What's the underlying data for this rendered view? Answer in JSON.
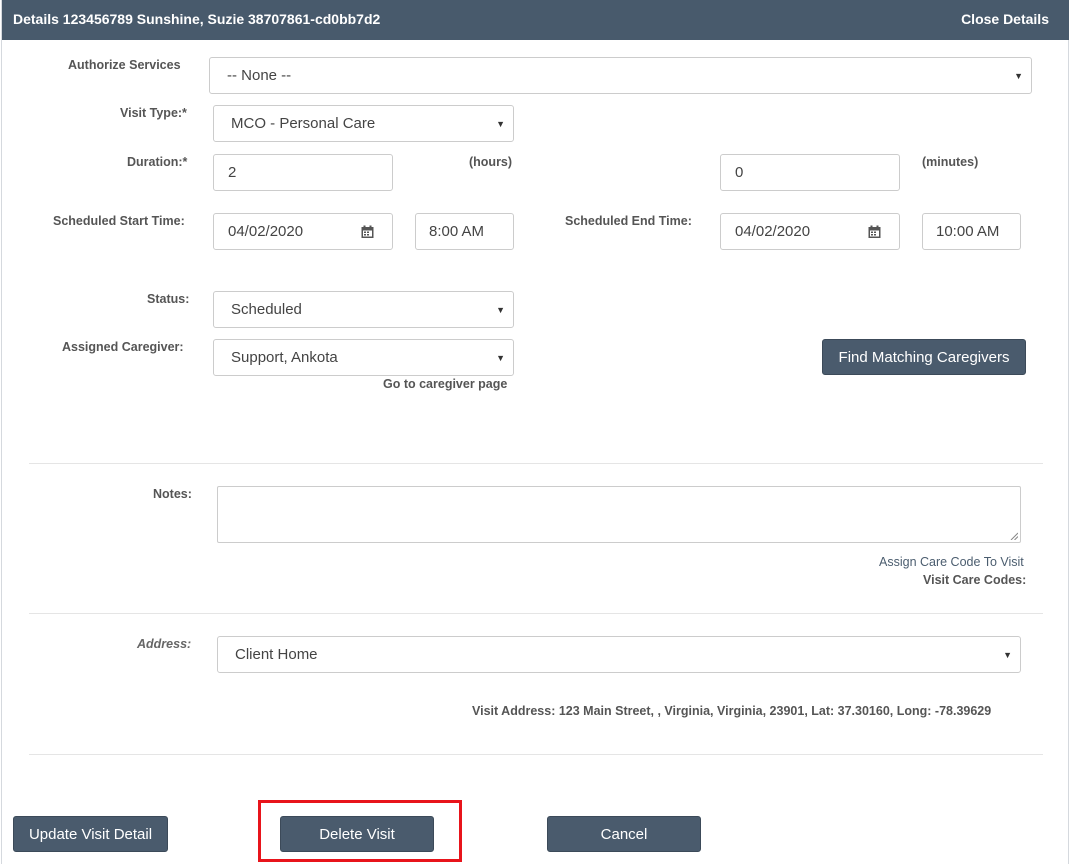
{
  "header": {
    "title": "Details 123456789 Sunshine, Suzie 38707861-cd0bb7d2",
    "close_label": "Close Details"
  },
  "form": {
    "authorize_services": {
      "label": "Authorize Services",
      "value": "-- None --"
    },
    "visit_type": {
      "label": "Visit Type:*",
      "value": "MCO - Personal Care"
    },
    "duration": {
      "label": "Duration:*",
      "hours_value": "2",
      "hours_unit": "(hours)",
      "minutes_value": "0",
      "minutes_unit": "(minutes)"
    },
    "scheduled_start": {
      "label": "Scheduled Start Time:",
      "date": "04/02/2020",
      "time": "8:00 AM"
    },
    "scheduled_end": {
      "label": "Scheduled End Time:",
      "date": "04/02/2020",
      "time": "10:00 AM"
    },
    "status": {
      "label": "Status:",
      "value": "Scheduled"
    },
    "assigned_caregiver": {
      "label": "Assigned Caregiver:",
      "value": "Support, Ankota",
      "go_link": "Go to caregiver page"
    },
    "find_matching_label": "Find Matching Caregivers",
    "notes": {
      "label": "Notes:",
      "value": ""
    },
    "assign_care_code_link": "Assign Care Code To Visit",
    "visit_care_codes_label": "Visit Care Codes:",
    "address": {
      "label": "Address:",
      "value": "Client Home"
    },
    "visit_address_text": "Visit Address: 123 Main Street, , Virginia, Virginia, 23901, Lat: 37.30160, Long: -78.39629"
  },
  "actions": {
    "update_label": "Update Visit Detail",
    "delete_label": "Delete Visit",
    "cancel_label": "Cancel"
  },
  "colors": {
    "header_bg": "#485a6c",
    "button_bg": "#4a5b6d",
    "highlight_border": "#e8141b"
  },
  "icons": {
    "select_caret": "caret-down-icon",
    "date_picker": "calendar-icon",
    "textarea_resize": "resize-grip-icon"
  }
}
